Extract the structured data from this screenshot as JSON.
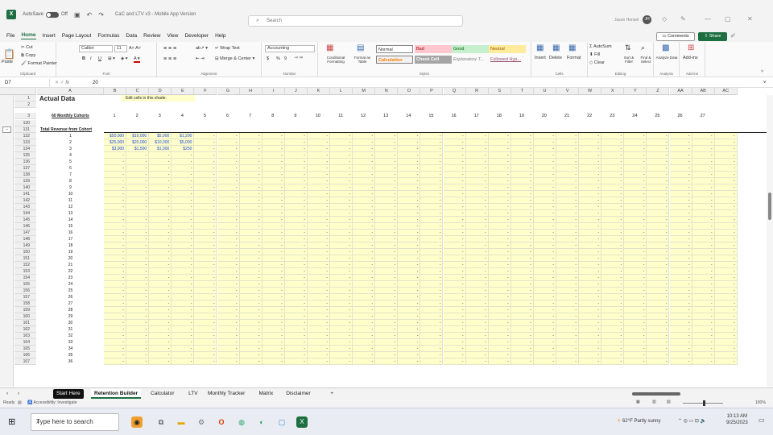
{
  "titlebar": {
    "autosave_label": "AutoSave",
    "autosave_state": "Off",
    "filename": "CaC and LTV v3 - Mobile App Version",
    "search_placeholder": "Search",
    "user_name": "Jason Hensel",
    "avatar_initials": "JH"
  },
  "menu": [
    "File",
    "Home",
    "Insert",
    "Page Layout",
    "Formulas",
    "Data",
    "Review",
    "View",
    "Developer",
    "Help"
  ],
  "menu_active": "Home",
  "comments_label": "Comments",
  "share_label": "Share",
  "ribbon": {
    "clipboard": {
      "cut": "Cut",
      "copy": "Copy",
      "format_painter": "Format Painter",
      "paste": "Paste",
      "label": "Clipboard"
    },
    "font": {
      "name": "Calibri",
      "size": "11",
      "label": "Font",
      "bold": "B",
      "italic": "I",
      "underline": "U"
    },
    "alignment": {
      "wrap": "Wrap Text",
      "merge": "Merge & Center",
      "label": "Alignment"
    },
    "number": {
      "format": "Accounting",
      "label": "Number",
      "currency": "$",
      "percent": "%",
      "comma": "9"
    },
    "styles": {
      "cond": "Conditional Formatting",
      "table": "Format as Table",
      "normal": "Normal",
      "bad": "Bad",
      "good": "Good",
      "neutral": "Neutral",
      "calculation": "Calculation",
      "check": "Check Cell",
      "explanatory": "Explanatory T...",
      "followed": "Followed Hyp...",
      "label": "Styles"
    },
    "cells": {
      "insert": "Insert",
      "delete": "Delete",
      "format": "Format",
      "label": "Cells"
    },
    "editing": {
      "autosum": "AutoSum",
      "fill": "Fill",
      "clear": "Clear",
      "sort": "Sort & Filter",
      "find": "Find & Select",
      "label": "Editing"
    },
    "analysis": {
      "analyze": "Analyze Data",
      "label": "Analysis"
    },
    "addins": {
      "addins": "Add-ins",
      "label": "Add-ins"
    }
  },
  "formula": {
    "namebox": "D7",
    "fx": "fx",
    "value": "20"
  },
  "grid": {
    "columns": [
      "A",
      "B",
      "C",
      "D",
      "E",
      "F",
      "G",
      "H",
      "I",
      "J",
      "K",
      "L",
      "M",
      "N",
      "O",
      "P",
      "Q",
      "R",
      "S",
      "T",
      "U",
      "V",
      "W",
      "X",
      "Y",
      "Z",
      "AA",
      "AB",
      "AC"
    ],
    "title": "Actual Data",
    "note": "Edit cells in this shade.",
    "cohorts_header": "60 Monthly Cohorts",
    "month_numbers": [
      "1",
      "2",
      "3",
      "4",
      "5",
      "6",
      "7",
      "8",
      "9",
      "10",
      "11",
      "12",
      "13",
      "14",
      "15",
      "16",
      "17",
      "18",
      "19",
      "20",
      "21",
      "22",
      "23",
      "24",
      "25",
      "26",
      "27"
    ],
    "section_title": "Total Revenue from Cohort",
    "top_rows": [
      "1",
      "2",
      "3",
      "130",
      "131"
    ],
    "data_rows": [
      {
        "row": "132",
        "cohort": "1",
        "values": [
          "$50,000",
          "$10,000",
          "$5,000",
          "$1,200"
        ]
      },
      {
        "row": "133",
        "cohort": "2",
        "values": [
          "$25,000",
          "$20,000",
          "$10,000",
          "$5,000"
        ]
      },
      {
        "row": "134",
        "cohort": "3",
        "values": [
          "$3,000",
          "$1,500",
          "$1,000",
          "$250"
        ]
      },
      {
        "row": "135",
        "cohort": "4"
      },
      {
        "row": "136",
        "cohort": "5"
      },
      {
        "row": "137",
        "cohort": "6"
      },
      {
        "row": "138",
        "cohort": "7"
      },
      {
        "row": "139",
        "cohort": "8"
      },
      {
        "row": "140",
        "cohort": "9"
      },
      {
        "row": "141",
        "cohort": "10"
      },
      {
        "row": "142",
        "cohort": "11"
      },
      {
        "row": "143",
        "cohort": "12"
      },
      {
        "row": "144",
        "cohort": "13"
      },
      {
        "row": "145",
        "cohort": "14"
      },
      {
        "row": "146",
        "cohort": "15"
      },
      {
        "row": "147",
        "cohort": "16"
      },
      {
        "row": "148",
        "cohort": "17"
      },
      {
        "row": "149",
        "cohort": "18"
      },
      {
        "row": "150",
        "cohort": "19"
      },
      {
        "row": "151",
        "cohort": "20"
      },
      {
        "row": "152",
        "cohort": "21"
      },
      {
        "row": "153",
        "cohort": "22"
      },
      {
        "row": "154",
        "cohort": "23"
      },
      {
        "row": "155",
        "cohort": "24"
      },
      {
        "row": "156",
        "cohort": "25"
      },
      {
        "row": "157",
        "cohort": "26"
      },
      {
        "row": "158",
        "cohort": "27"
      },
      {
        "row": "159",
        "cohort": "28"
      },
      {
        "row": "160",
        "cohort": "29"
      },
      {
        "row": "161",
        "cohort": "30"
      },
      {
        "row": "162",
        "cohort": "31"
      },
      {
        "row": "163",
        "cohort": "32"
      },
      {
        "row": "164",
        "cohort": "33"
      },
      {
        "row": "165",
        "cohort": "34"
      },
      {
        "row": "166",
        "cohort": "35"
      },
      {
        "row": "167",
        "cohort": "36"
      }
    ],
    "empty_value": "-"
  },
  "sheets": [
    "Start Here",
    "Retention Builder",
    "Calculator",
    "LTV",
    "Monthly Tracker",
    "Matrix",
    "Disclaimer"
  ],
  "active_sheet": "Retention Builder",
  "status": {
    "ready": "Ready",
    "accessibility": "Accessibility: Investigate",
    "zoom": "100%"
  },
  "taskbar": {
    "search_placeholder": "Type here to search",
    "weather": "62°F Partly sunny",
    "time": "10:13 AM",
    "date": "9/25/2023"
  },
  "colors": {
    "excel_green": "#1d6f42",
    "edit_shade": "#ffffcc",
    "input_blue": "#1f4bd1"
  }
}
